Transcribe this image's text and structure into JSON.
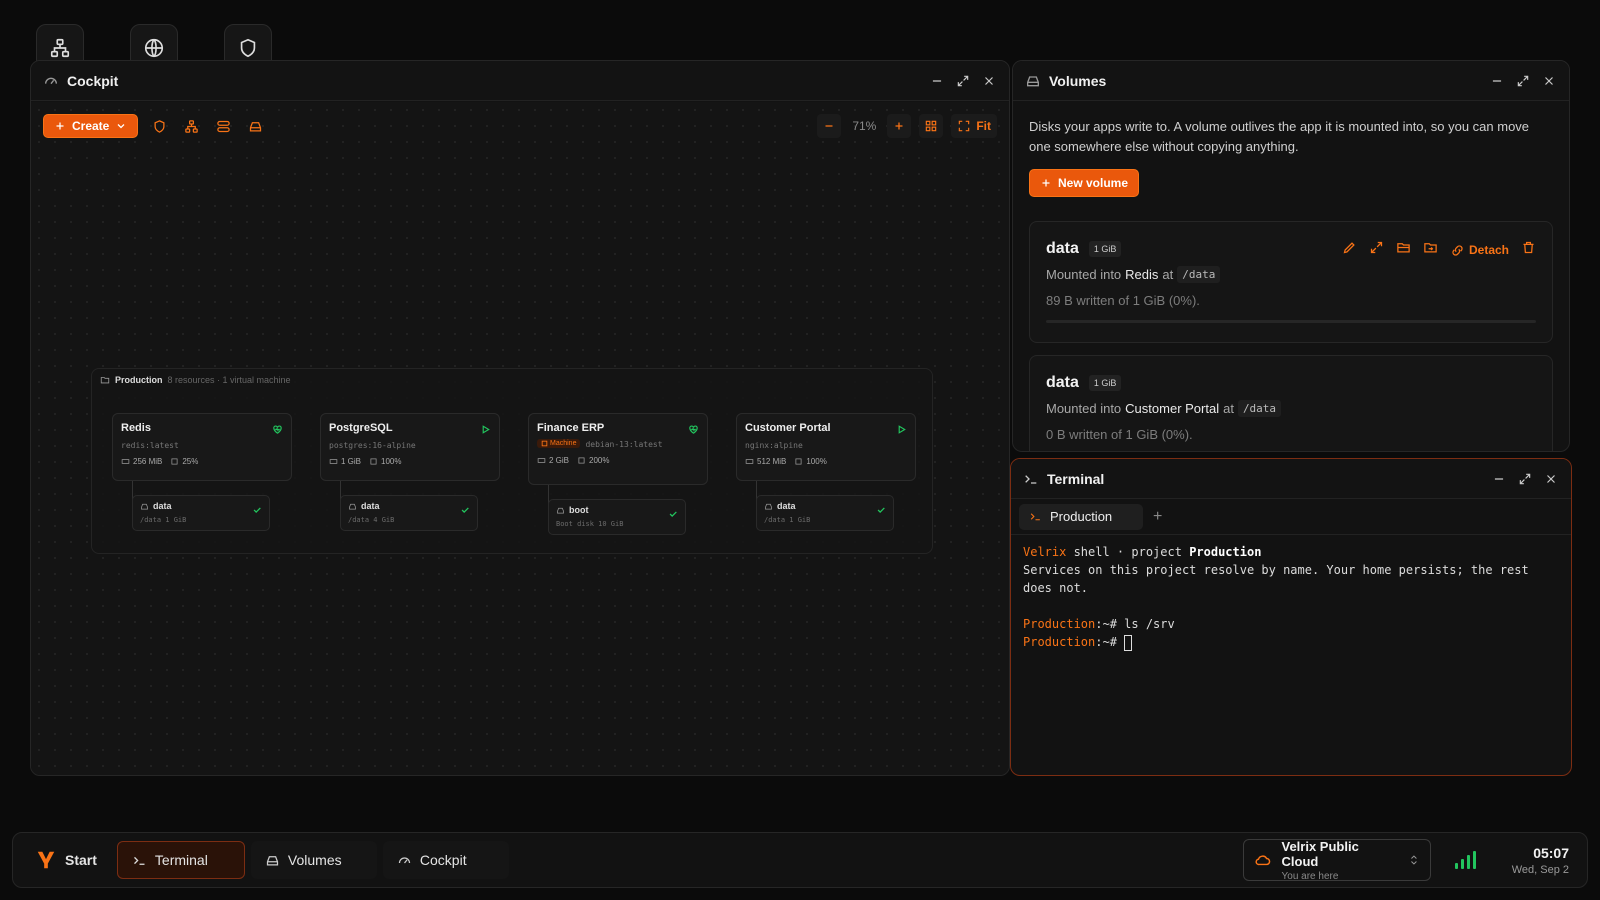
{
  "desktop": {
    "icons": [
      "network-icon",
      "globe-icon",
      "shield-icon"
    ]
  },
  "cockpit": {
    "title": "Cockpit",
    "create_label": "Create",
    "zoom": "71%",
    "fit_label": "Fit",
    "group": {
      "name": "Production",
      "meta": "8 resources · 1 virtual machine"
    },
    "nodes": [
      {
        "name": "Redis",
        "image": "redis:latest",
        "mem": "256 MiB",
        "cpu": "25%",
        "vol_name": "data",
        "vol_sub": "/data 1 GiB"
      },
      {
        "name": "PostgreSQL",
        "image": "postgres:16-alpine",
        "mem": "1 GiB",
        "cpu": "100%",
        "vol_name": "data",
        "vol_sub": "/data 4 GiB"
      },
      {
        "name": "Finance ERP",
        "badge": "Machine",
        "image": "debian-13:latest",
        "mem": "2 GiB",
        "cpu": "200%",
        "vol_name": "boot",
        "vol_sub": "Boot disk 10 GiB"
      },
      {
        "name": "Customer Portal",
        "image": "nginx:alpine",
        "mem": "512 MiB",
        "cpu": "100%",
        "vol_name": "data",
        "vol_sub": "/data 1 GiB"
      }
    ]
  },
  "volumes": {
    "title": "Volumes",
    "description": "Disks your apps write to. A volume outlives the app it is mounted into, so you can move one somewhere else without copying anything.",
    "new_label": "New volume",
    "detach_label": "Detach",
    "items": [
      {
        "name": "data",
        "size": "1 GiB",
        "mounted_prefix": "Mounted into",
        "app": "Redis",
        "at": "at",
        "path": "/data",
        "written": "89 B written of 1 GiB (0%).",
        "usage": 0
      },
      {
        "name": "data",
        "size": "1 GiB",
        "mounted_prefix": "Mounted into",
        "app": "Customer Portal",
        "at": "at",
        "path": "/data",
        "written": "0 B written of 1 GiB (0%).",
        "usage": 0
      }
    ]
  },
  "terminal": {
    "title": "Terminal",
    "tab_label": "Production",
    "add_label": "+",
    "lines": {
      "l1_brand": "Velrix",
      "l1_mid": " shell · project ",
      "l1_project": "Production",
      "l2": "Services on this project resolve by name. Your home persists; the rest does not.",
      "prompt_host": "Production",
      "prompt_tail": ":~# ",
      "cmd1": "ls /srv"
    }
  },
  "taskbar": {
    "start": "Start",
    "items": [
      "Terminal",
      "Volumes",
      "Cockpit"
    ],
    "cloud_title": "Velrix Public Cloud",
    "cloud_sub": "You are here",
    "time": "05:07",
    "date": "Wed, Sep 2"
  },
  "colors": {
    "accent": "#f97316",
    "ok": "#22c55e"
  }
}
